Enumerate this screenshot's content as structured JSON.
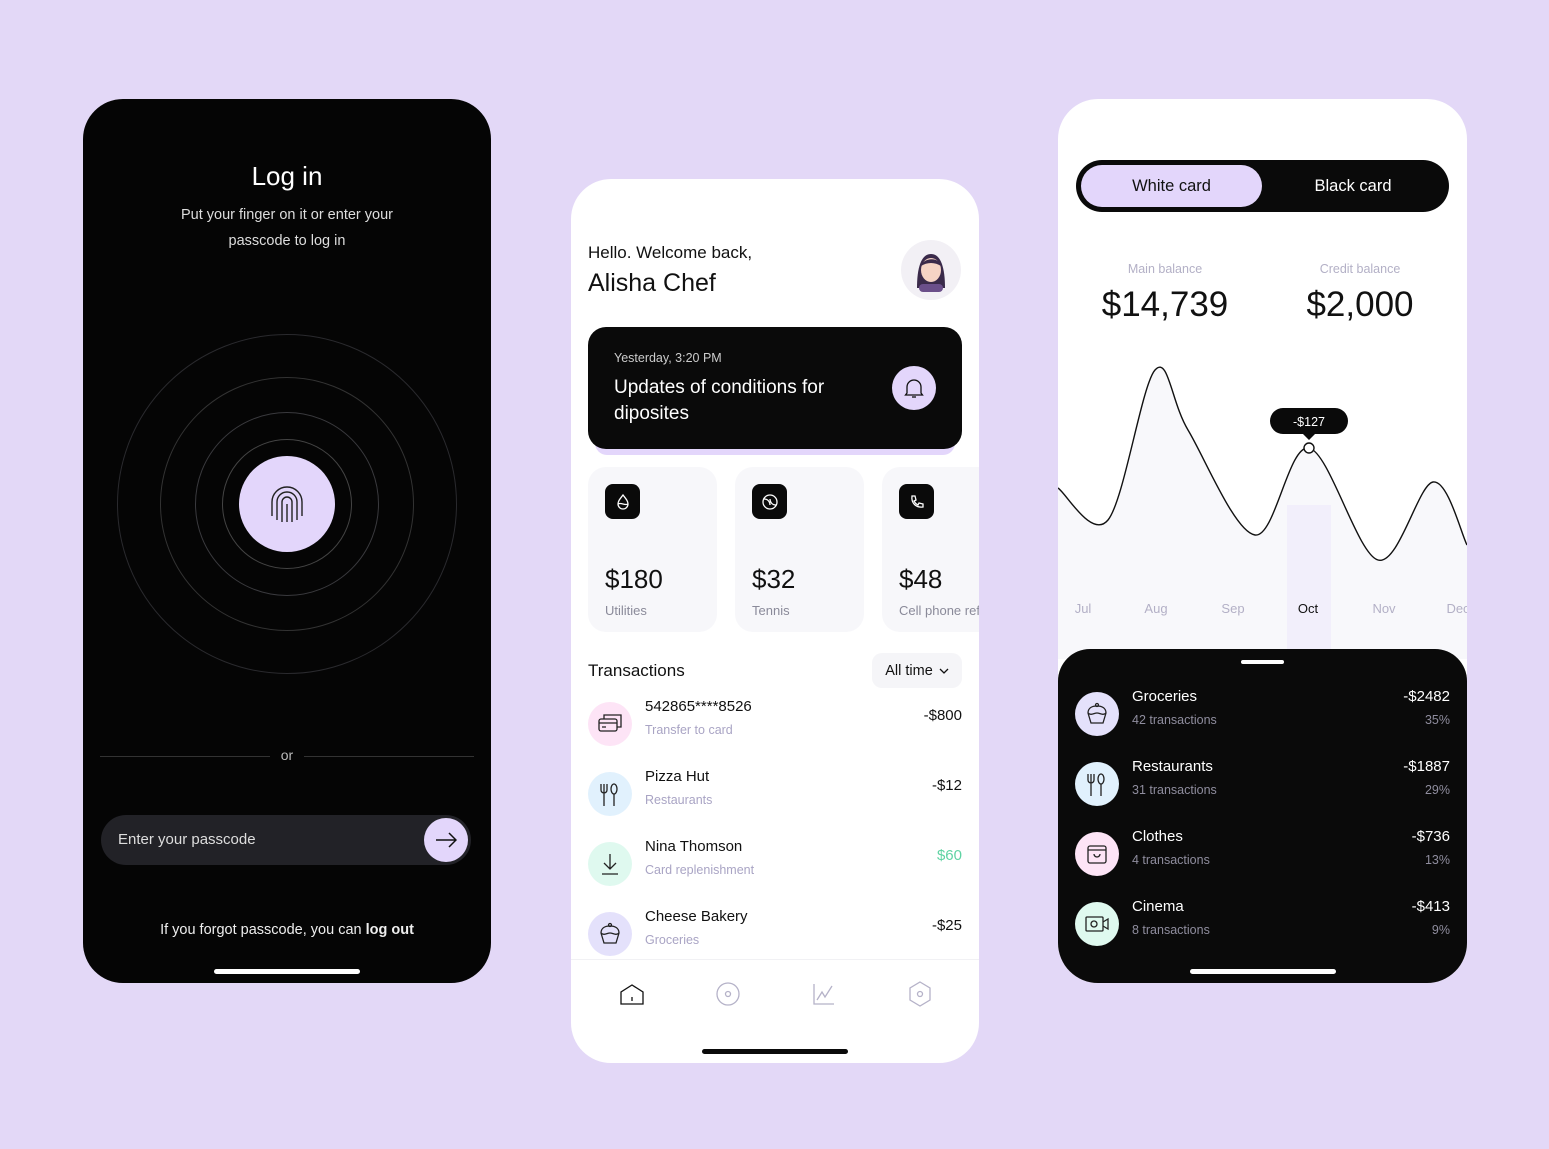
{
  "login": {
    "title": "Log in",
    "subtitle_line1": "Put your finger on it or enter your",
    "subtitle_line2": "passcode to log in",
    "or": "or",
    "passcode_placeholder": "Enter your passcode",
    "forgot_text": "If you forgot passcode, you can ",
    "logout_link": "log out"
  },
  "home": {
    "greeting": "Hello. Welcome back,",
    "name": "Alisha Chef",
    "notification": {
      "time": "Yesterday, 3:20 PM",
      "text_line1": "Updates of conditions for",
      "text_line2": "diposites"
    },
    "stats": [
      {
        "icon": "drop-icon",
        "amount": "$180",
        "label": "Utilities"
      },
      {
        "icon": "tennis-ball-icon",
        "amount": "$32",
        "label": "Tennis"
      },
      {
        "icon": "phone-icon",
        "amount": "$48",
        "label": "Cell phone refill"
      }
    ],
    "transactions_title": "Transactions",
    "filter": "All time",
    "transactions": [
      {
        "icon": "card-icon",
        "title": "542865****8526",
        "subtitle": "Transfer to card",
        "amount": "-$800",
        "color": "#fde4f6"
      },
      {
        "icon": "fork-spoon-icon",
        "title": "Pizza Hut",
        "subtitle": "Restaurants",
        "amount": "-$12",
        "color": "#e1f1fd"
      },
      {
        "icon": "download-icon",
        "title": "Nina Thomson",
        "subtitle": "Card replenishment",
        "amount": "$60",
        "color": "#dff9ef",
        "amount_color": "#5fd3a3"
      },
      {
        "icon": "cupcake-icon",
        "title": "Cheese Bakery",
        "subtitle": "Groceries",
        "amount": "-$25",
        "color": "#e4e1fb"
      }
    ],
    "nav": [
      "home-icon",
      "target-icon",
      "chart-icon",
      "settings-hexagon-icon"
    ]
  },
  "cards": {
    "tabs": [
      "White card",
      "Black card"
    ],
    "active_tab": "White card",
    "main_balance_label": "Main balance",
    "main_balance": "$14,739",
    "credit_balance_label": "Credit balance",
    "credit_balance": "$2,000",
    "chart": {
      "months": [
        "Jul",
        "Aug",
        "Sep",
        "Oct",
        "Nov",
        "Dec"
      ],
      "selected": "Oct",
      "tooltip": "-$127"
    },
    "categories": [
      {
        "icon": "cupcake-icon",
        "name": "Groceries",
        "count": "42 transactions",
        "amount": "-$2482",
        "percent": "35%",
        "color": "#e4e1fb"
      },
      {
        "icon": "fork-spoon-icon",
        "name": "Restaurants",
        "count": "31 transactions",
        "amount": "-$1887",
        "percent": "29%",
        "color": "#e1f1fd"
      },
      {
        "icon": "bag-icon",
        "name": "Clothes",
        "count": "4 transactions",
        "amount": "-$736",
        "percent": "13%",
        "color": "#fde4f6"
      },
      {
        "icon": "video-camera-icon",
        "name": "Cinema",
        "count": "8 transactions",
        "amount": "-$413",
        "percent": "9%",
        "color": "#dff9ef"
      }
    ]
  },
  "colors": {
    "accent": "#e3d6fb",
    "background": "#e3d8f7",
    "dark": "#050505",
    "positive": "#5fd3a3"
  }
}
